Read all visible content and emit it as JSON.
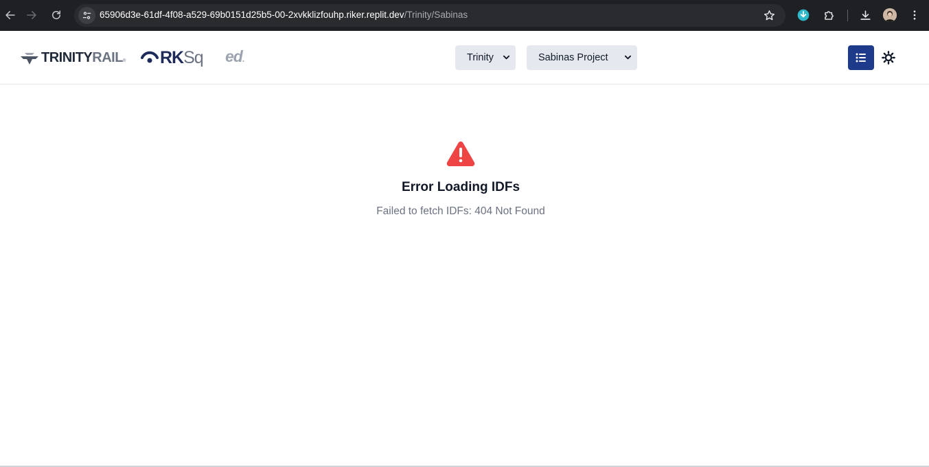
{
  "browser": {
    "url_host": "65906d3e-61df-4f08-a529-69b0151d25b5-00-2xvkklizfouhp.riker.replit.dev",
    "url_path": "/Trinity/Sabinas"
  },
  "header": {
    "logos": {
      "trinity_main": "TRINITY",
      "trinity_rail": "RAIL",
      "trinity_tm": "®",
      "rksq_rk": "RK",
      "rksq_sq": "Sq",
      "ed": "ed",
      "ed_dot": "."
    },
    "company_select": {
      "selected": "Trinity"
    },
    "project_select": {
      "selected": "Sabinas Project"
    }
  },
  "main": {
    "error_title": "Error Loading IDFs",
    "error_message": "Failed to fetch IDFs: 404 Not Found"
  },
  "colors": {
    "brand_primary": "#1e3a8a",
    "error_red": "#ef4444",
    "select_bg": "#e5e9ef",
    "chrome_bg": "#1f2023"
  },
  "icons": [
    "back-arrow-icon",
    "forward-arrow-icon",
    "reload-icon",
    "site-settings-icon",
    "star-icon",
    "extension-download-icon",
    "extensions-puzzle-icon",
    "downloads-icon",
    "profile-avatar",
    "more-menu-icon",
    "list-icon",
    "sun-icon",
    "warning-triangle-icon"
  ]
}
